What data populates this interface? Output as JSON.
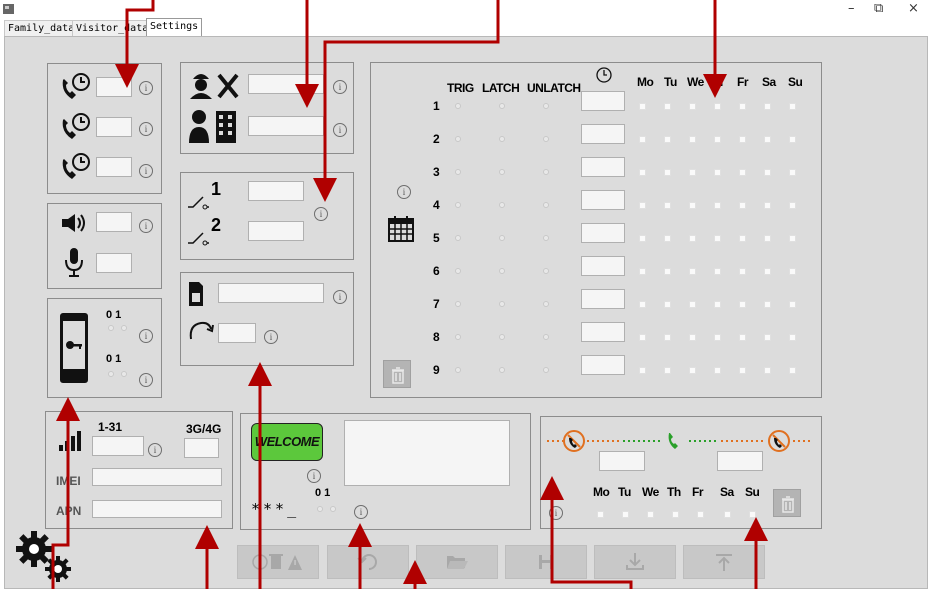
{
  "window": {
    "minimize": "–",
    "restore": "⧉",
    "close": "×"
  },
  "tabs": [
    "Family_data",
    "Visitor_data",
    "Settings"
  ],
  "scheduler": {
    "headers": {
      "trig": "TRIG",
      "latch": "LATCH",
      "unlatch": "UNLATCH",
      "days": [
        "Mo",
        "Tu",
        "We",
        "Th",
        "Fr",
        "Sa",
        "Su"
      ]
    },
    "rows": [
      "1",
      "2",
      "3",
      "4",
      "5",
      "6",
      "7",
      "8",
      "9"
    ]
  },
  "keypad": {
    "row1_label": "0 1",
    "row2_label": "0 1"
  },
  "network": {
    "range_label": "1-31",
    "mode_label": "3G/4G",
    "imei_label": "IMEI",
    "apn_label": "APN"
  },
  "welcome": {
    "logo_text": "WELCOME",
    "mask_text": "***_",
    "toggle_label": "0 1"
  },
  "timeband": {
    "days": [
      "Mo",
      "Tu",
      "We",
      "Th",
      "Fr",
      "Sa",
      "Su"
    ]
  },
  "relay": {
    "one": "1",
    "two": "2"
  },
  "info_glyph": "i",
  "icons": {
    "trash": "🗑",
    "warning": "⚠"
  },
  "colors": {
    "arrow": "#b00000",
    "welcome_bg": "#5cc83c",
    "green_icon": "#2aa02a",
    "orange_icon": "#e07020"
  }
}
